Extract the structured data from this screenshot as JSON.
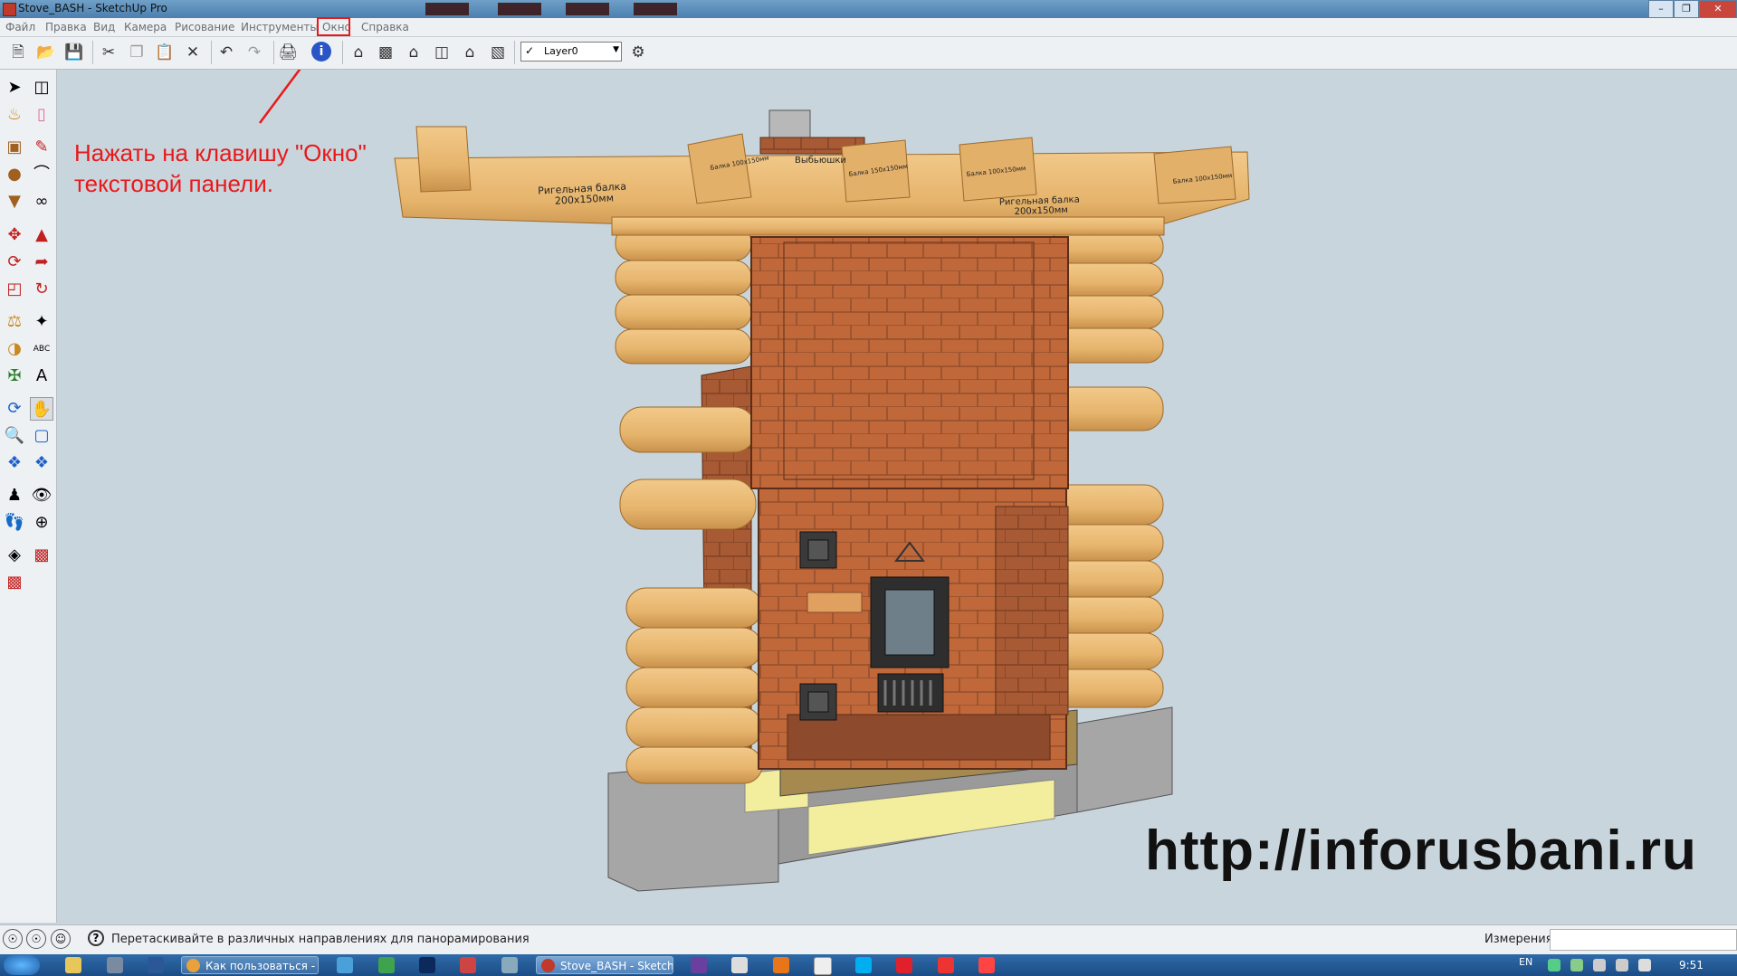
{
  "window": {
    "title": "Stove_BASH - SketchUp Pro"
  },
  "menu": {
    "items": [
      "Файл",
      "Правка",
      "Вид",
      "Камера",
      "Рисование",
      "Инструменты",
      "Окно",
      "Справка"
    ],
    "highlighted": "Окно",
    "highlight_color": "#e8191b"
  },
  "toolbar": {
    "icons": [
      "new-icon",
      "open-icon",
      "save-icon",
      "cut-icon",
      "copy-icon",
      "paste-icon",
      "erase-icon",
      "undo-icon",
      "redo-icon",
      "print-icon",
      "model-info-icon",
      "iso-view-icon",
      "top-view-icon",
      "front-view-icon",
      "right-view-icon",
      "back-view-icon",
      "left-view-icon",
      "layers-icon"
    ],
    "layer_name": "Layer0"
  },
  "annotation": {
    "text": "Нажать на клавишу \"Окно\"\nтекстовой панели.",
    "color": "#e8191b"
  },
  "model_labels": {
    "beam_left": "Ригельная балка\n200х150мм",
    "beam_right": "Ригельная балка\n200х150мм",
    "chimney": "Выбьюшки",
    "beam_tags": [
      "Балка 100х150мм",
      "Балка 150х150мм",
      "Балка 100х150мм",
      "Балка 100х150мм"
    ]
  },
  "watermark": "http://inforusbani.ru",
  "statusbar": {
    "message": "Перетаскивайте в различных направлениях для панорамирования",
    "measurements_label": "Измерения",
    "measurements_value": ""
  },
  "taskbar": {
    "tasks": [
      "Как пользоваться - ...",
      "Stove_BASH - Sketch..."
    ],
    "language": "EN",
    "clock": "9:51"
  },
  "colors": {
    "viewport_bg": "#c9d5dc",
    "brick": "#c0683a",
    "log": "#e8b774",
    "foundation": "#a6a6a6",
    "plinth": "#f3ee9e"
  }
}
